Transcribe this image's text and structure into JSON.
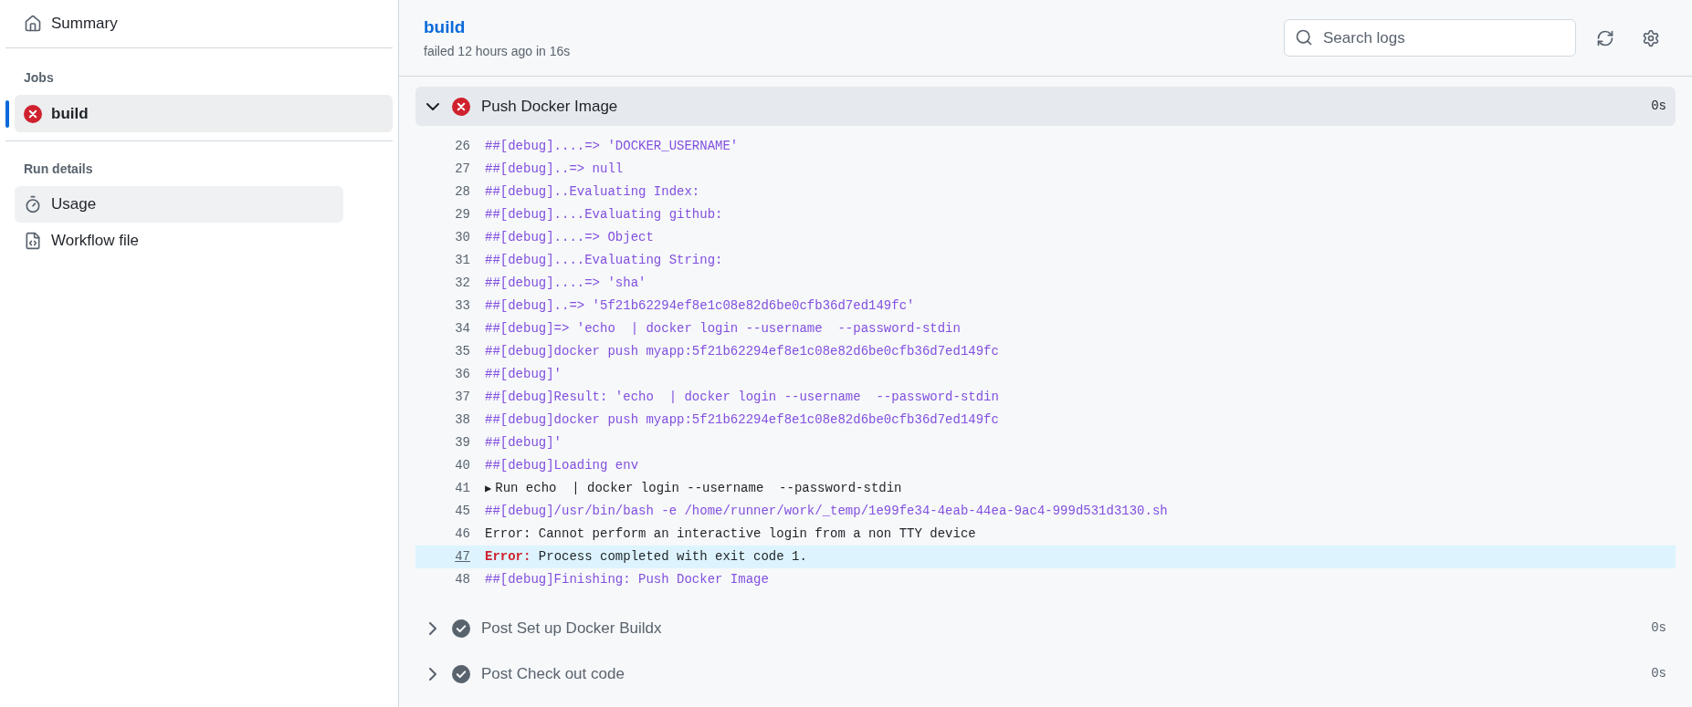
{
  "sidebar": {
    "summary": "Summary",
    "jobs_label": "Jobs",
    "jobs": [
      {
        "name": "build",
        "failed": true,
        "selected": true
      }
    ],
    "run_details_label": "Run details",
    "run_details": [
      {
        "label": "Usage",
        "kind": "usage",
        "selected": true
      },
      {
        "label": "Workflow file",
        "kind": "file",
        "selected": false
      }
    ]
  },
  "header": {
    "title": "build",
    "subtitle": "failed 12 hours ago in 16s",
    "search": {
      "placeholder": "Search logs"
    }
  },
  "steps": [
    {
      "name": "Push Docker Image",
      "failed": true,
      "expanded": true,
      "duration": "0s",
      "lines": [
        {
          "number": "26",
          "kind": "debug",
          "text": "##[debug]....=> 'DOCKER_USERNAME'",
          "selected": false
        },
        {
          "number": "27",
          "kind": "debug",
          "text": "##[debug]..=> null",
          "selected": false
        },
        {
          "number": "28",
          "kind": "debug",
          "text": "##[debug]..Evaluating Index:",
          "selected": false
        },
        {
          "number": "29",
          "kind": "debug",
          "text": "##[debug]....Evaluating github:",
          "selected": false
        },
        {
          "number": "30",
          "kind": "debug",
          "text": "##[debug]....=> Object",
          "selected": false
        },
        {
          "number": "31",
          "kind": "debug",
          "text": "##[debug]....Evaluating String:",
          "selected": false
        },
        {
          "number": "32",
          "kind": "debug",
          "text": "##[debug]....=> 'sha'",
          "selected": false
        },
        {
          "number": "33",
          "kind": "debug",
          "text": "##[debug]..=> '5f21b62294ef8e1c08e82d6be0cfb36d7ed149fc'",
          "selected": false
        },
        {
          "number": "34",
          "kind": "debug",
          "text": "##[debug]=> 'echo  | docker login --username  --password-stdin",
          "selected": false
        },
        {
          "number": "35",
          "kind": "debug",
          "text": "##[debug]docker push myapp:5f21b62294ef8e1c08e82d6be0cfb36d7ed149fc",
          "selected": false
        },
        {
          "number": "36",
          "kind": "debug",
          "text": "##[debug]'",
          "selected": false
        },
        {
          "number": "37",
          "kind": "debug",
          "text": "##[debug]Result: 'echo  | docker login --username  --password-stdin",
          "selected": false
        },
        {
          "number": "38",
          "kind": "debug",
          "text": "##[debug]docker push myapp:5f21b62294ef8e1c08e82d6be0cfb36d7ed149fc",
          "selected": false
        },
        {
          "number": "39",
          "kind": "debug",
          "text": "##[debug]'",
          "selected": false
        },
        {
          "number": "40",
          "kind": "debug",
          "text": "##[debug]Loading env",
          "selected": false
        },
        {
          "number": "41",
          "kind": "group",
          "marker": "▶",
          "text": "Run echo  | docker login --username  --password-stdin",
          "selected": false
        },
        {
          "number": "45",
          "kind": "debug",
          "text": "##[debug]/usr/bin/bash -e /home/runner/work/_temp/1e99fe34-4eab-44ea-9ac4-999d531d3130.sh",
          "selected": false
        },
        {
          "number": "46",
          "kind": "plain",
          "text": "Error: Cannot perform an interactive login from a non TTY device",
          "selected": false
        },
        {
          "number": "47",
          "kind": "error",
          "prefix": "Error:",
          "text": "Process completed with exit code 1.",
          "selected": true
        },
        {
          "number": "48",
          "kind": "debug",
          "text": "##[debug]Finishing: Push Docker Image",
          "selected": false
        }
      ]
    },
    {
      "name": "Post Set up Docker Buildx",
      "failed": false,
      "expanded": false,
      "duration": "0s"
    },
    {
      "name": "Post Check out code",
      "failed": false,
      "expanded": false,
      "duration": "0s"
    }
  ]
}
